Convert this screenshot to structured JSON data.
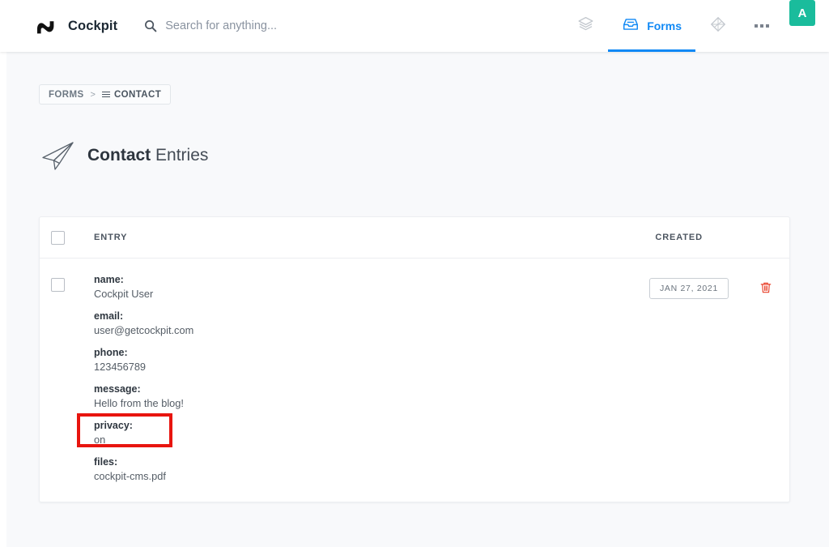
{
  "app": {
    "brand_name": "Cockpit",
    "logo_icon": "cockpit-logo-icon"
  },
  "search": {
    "placeholder": "Search for anything...",
    "value": "",
    "icon": "search-icon"
  },
  "header_nav": {
    "items": [
      {
        "id": "collections",
        "icon": "layers-icon",
        "label": "",
        "active": false
      },
      {
        "id": "forms",
        "icon": "inbox-icon",
        "label": "Forms",
        "active": true
      },
      {
        "id": "finder",
        "icon": "diamond-icon",
        "label": "",
        "active": false
      },
      {
        "id": "more",
        "icon": "more-dots-icon",
        "label": "",
        "active": false
      }
    ],
    "avatar": {
      "initial": "A",
      "color": "#1abc9c",
      "icon": "avatar"
    }
  },
  "breadcrumb": {
    "root_label": "FORMS",
    "separator": ">",
    "current_label": "CONTACT",
    "current_icon": "list-icon"
  },
  "page": {
    "title_bold": "Contact",
    "title_rest": "Entries",
    "title_icon": "paper-plane-icon"
  },
  "table": {
    "columns": {
      "entry": "ENTRY",
      "created": "CREATED"
    },
    "rows": [
      {
        "fields": [
          {
            "key": "name:",
            "value": "Cockpit User"
          },
          {
            "key": "email:",
            "value": "user@getcockpit.com"
          },
          {
            "key": "phone:",
            "value": "123456789"
          },
          {
            "key": "message:",
            "value": "Hello from the blog!"
          },
          {
            "key": "privacy:",
            "value": "on"
          },
          {
            "key": "files:",
            "value": "cockpit-cms.pdf"
          }
        ],
        "created": "JAN 27, 2021",
        "delete_icon": "trash-icon"
      }
    ]
  },
  "colors": {
    "accent_blue": "#1189f5",
    "avatar_green": "#1abc9c",
    "annotation_red": "#e8150f",
    "delete_red": "#e8402a",
    "page_bg": "#f8f9fb"
  },
  "annotation": {
    "target": "files-field",
    "color": "#e8150f"
  }
}
